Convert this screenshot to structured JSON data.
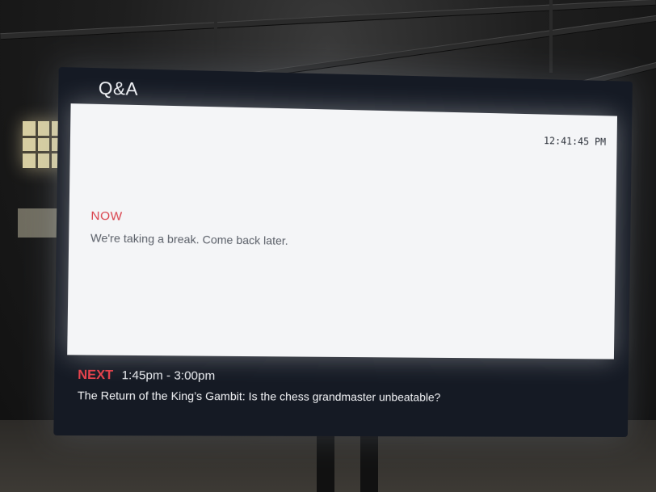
{
  "screen": {
    "title": "Q&A",
    "clock": "12:41:45 PM"
  },
  "now": {
    "label": "NOW",
    "message": "We're taking a break. Come back later."
  },
  "next": {
    "label": "NEXT",
    "time": "1:45pm - 3:00pm",
    "title": "The Return of the King’s Gambit: Is the chess grandmaster unbeatable?"
  },
  "colors": {
    "accent_red": "#e5434d",
    "screen_bezel": "#151a24",
    "panel": "#f4f5f7"
  }
}
